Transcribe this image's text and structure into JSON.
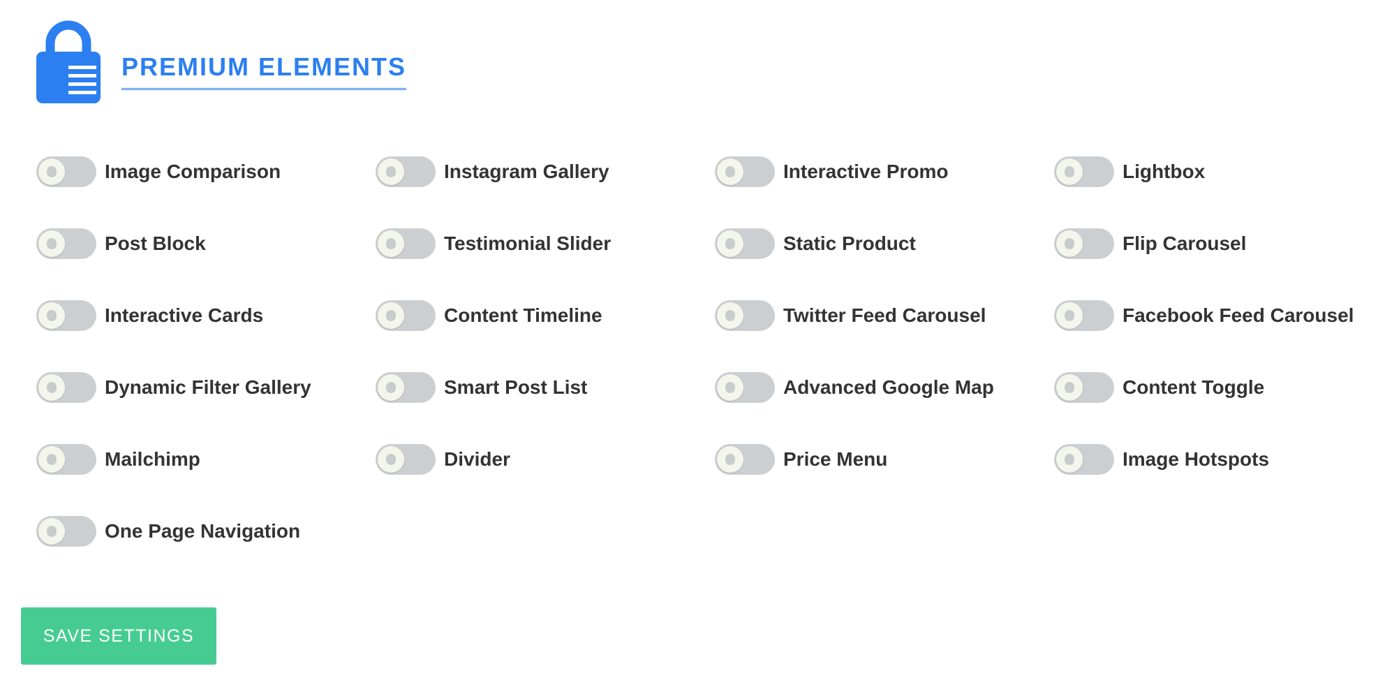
{
  "header": {
    "title": "PREMIUM ELEMENTS",
    "icon": "lock-icon",
    "accent_color": "#2b7ff0"
  },
  "elements": [
    {
      "label": "Image Comparison",
      "enabled": false
    },
    {
      "label": "Instagram Gallery",
      "enabled": false
    },
    {
      "label": "Interactive Promo",
      "enabled": false
    },
    {
      "label": "Lightbox",
      "enabled": false
    },
    {
      "label": "Post Block",
      "enabled": false
    },
    {
      "label": "Testimonial Slider",
      "enabled": false
    },
    {
      "label": "Static Product",
      "enabled": false
    },
    {
      "label": "Flip Carousel",
      "enabled": false
    },
    {
      "label": "Interactive Cards",
      "enabled": false
    },
    {
      "label": "Content Timeline",
      "enabled": false
    },
    {
      "label": "Twitter Feed Carousel",
      "enabled": false
    },
    {
      "label": "Facebook Feed Carousel",
      "enabled": false
    },
    {
      "label": "Dynamic Filter Gallery",
      "enabled": false
    },
    {
      "label": "Smart Post List",
      "enabled": false
    },
    {
      "label": "Advanced Google Map",
      "enabled": false
    },
    {
      "label": "Content Toggle",
      "enabled": false
    },
    {
      "label": "Mailchimp",
      "enabled": false
    },
    {
      "label": "Divider",
      "enabled": false
    },
    {
      "label": "Price Menu",
      "enabled": false
    },
    {
      "label": "Image Hotspots",
      "enabled": false
    },
    {
      "label": "One Page Navigation",
      "enabled": false
    }
  ],
  "save_button": {
    "label": "SAVE SETTINGS",
    "color": "#46cc93"
  },
  "toggle_colors": {
    "track_off": "#cccfd1",
    "knob": "#f4f6ec"
  }
}
